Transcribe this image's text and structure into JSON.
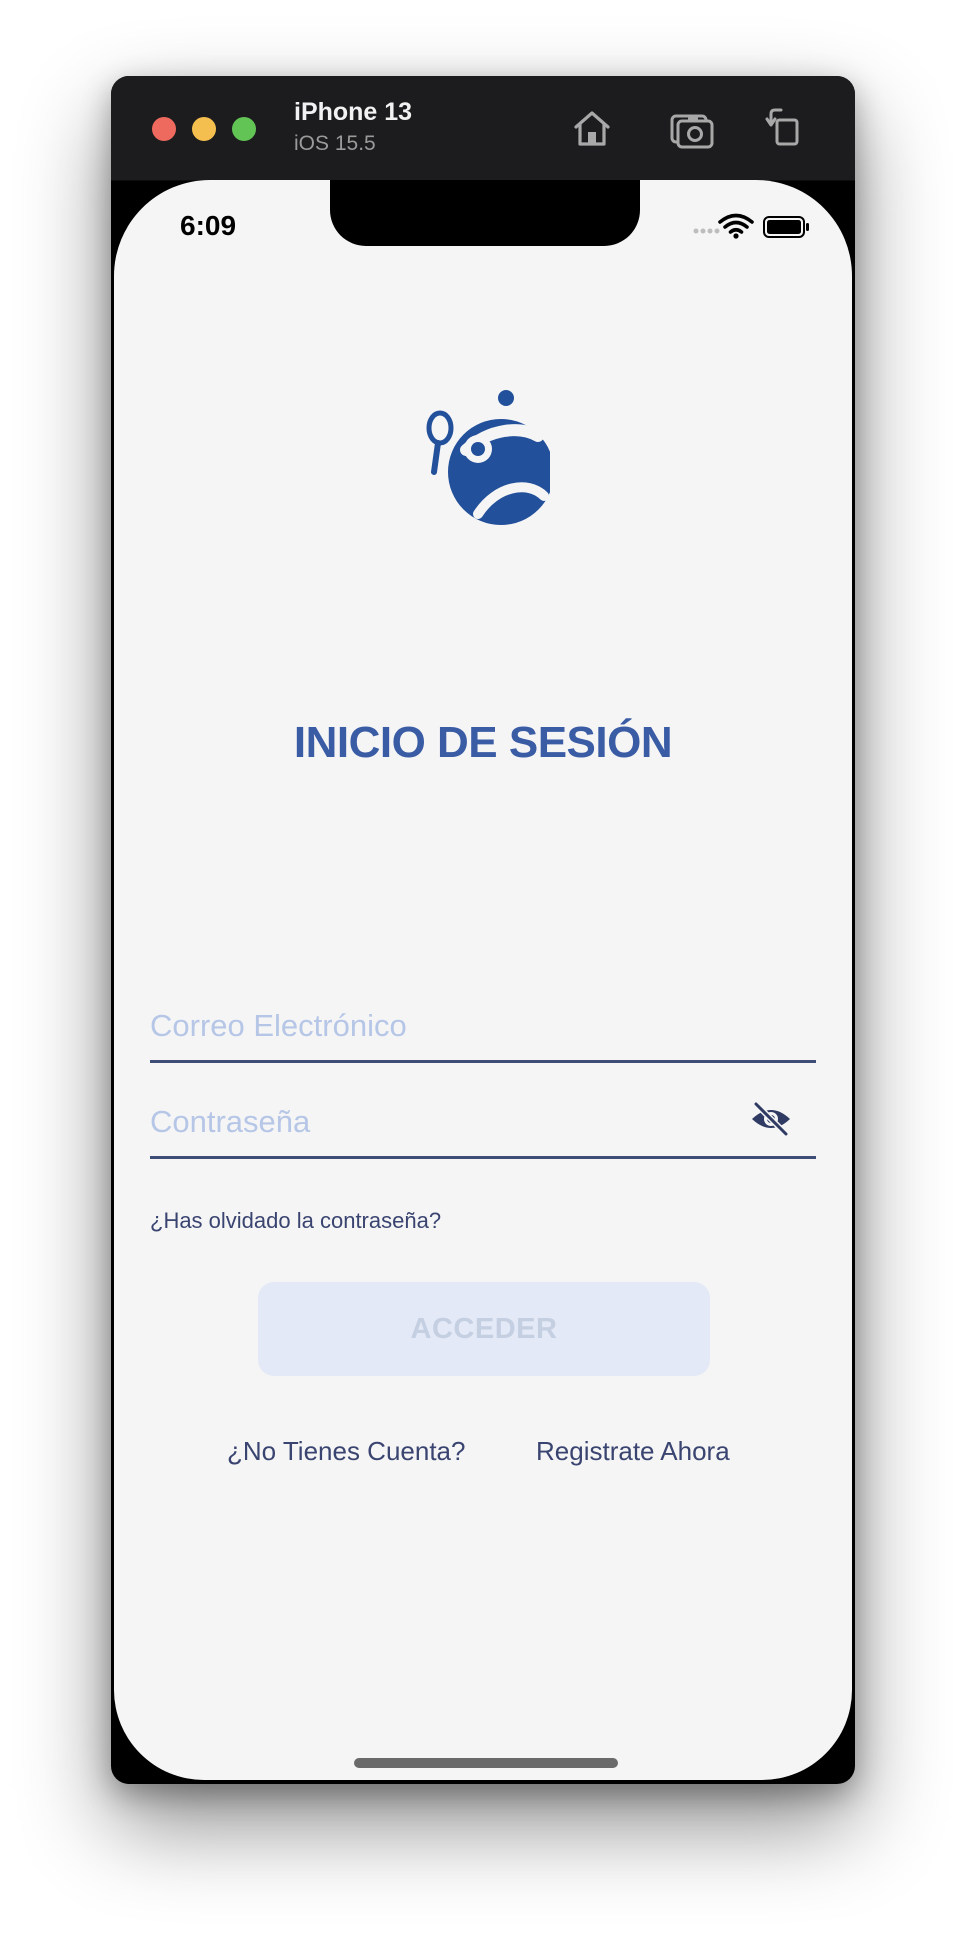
{
  "simulator": {
    "device_name": "iPhone 13",
    "os_version": "iOS 15.5",
    "toolbar_icons": [
      "home-icon",
      "screenshot-icon",
      "rotate-icon"
    ]
  },
  "status_bar": {
    "time": "6:09",
    "icons": [
      "signal-dots-icon",
      "wifi-icon",
      "battery-icon"
    ]
  },
  "brand": {
    "logo_icon": "tennis-player-logo",
    "color": "#23509a"
  },
  "login": {
    "title": "INICIO DE SESIÓN",
    "email_placeholder": "Correo Electrónico",
    "password_placeholder": "Contraseña",
    "password_toggle_icon": "eye-slash-icon",
    "forgot_password": "¿Has olvidado la contraseña?",
    "submit_label": "ACCEDER",
    "no_account_text": "¿No Tienes Cuenta?",
    "register_link": "Registrate Ahora"
  },
  "colors": {
    "title": "#3a5ca5",
    "text": "#3a4470",
    "placeholder": "#b6c6e6",
    "input_underline": "#3d4d78",
    "button_bg_disabled": "#e3e9f6",
    "button_text_disabled": "#c5cfe2",
    "screen_bg": "#f5f5f6"
  }
}
